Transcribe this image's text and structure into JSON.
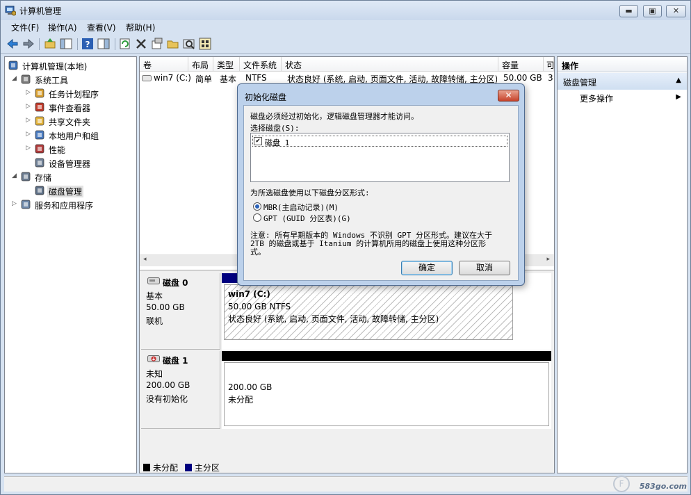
{
  "window": {
    "title": "计算机管理"
  },
  "menu": [
    "文件(F)",
    "操作(A)",
    "查看(V)",
    "帮助(H)"
  ],
  "tree": [
    {
      "label": "计算机管理(本地)",
      "level": 0,
      "expander": ""
    },
    {
      "label": "系统工具",
      "level": 1,
      "expander": "◢"
    },
    {
      "label": "任务计划程序",
      "level": 2,
      "expander": "▷"
    },
    {
      "label": "事件查看器",
      "level": 2,
      "expander": "▷"
    },
    {
      "label": "共享文件夹",
      "level": 2,
      "expander": "▷"
    },
    {
      "label": "本地用户和组",
      "level": 2,
      "expander": "▷"
    },
    {
      "label": "性能",
      "level": 2,
      "expander": "▷"
    },
    {
      "label": "设备管理器",
      "level": 2,
      "expander": ""
    },
    {
      "label": "存储",
      "level": 1,
      "expander": "◢"
    },
    {
      "label": "磁盘管理",
      "level": 2,
      "expander": "",
      "selected": true
    },
    {
      "label": "服务和应用程序",
      "level": 1,
      "expander": "▷"
    }
  ],
  "volume_list": {
    "headers": [
      "卷",
      "布局",
      "类型",
      "文件系统",
      "状态",
      "容量",
      "可"
    ],
    "rows": [
      {
        "volume": "win7 (C:)",
        "layout": "简单",
        "type": "基本",
        "fs": "NTFS",
        "status": "状态良好 (系统, 启动, 页面文件, 活动, 故障转储, 主分区)",
        "capacity": "50.00 GB",
        "free": "3"
      }
    ]
  },
  "disks": [
    {
      "name": "磁盘 0",
      "kind": "基本",
      "size": "50.00 GB",
      "state": "联机",
      "volume": {
        "name": "win7  (C:)",
        "size": "50.00 GB NTFS",
        "status": "状态良好 (系统, 启动, 页面文件, 活动, 故障转储, 主分区)"
      }
    },
    {
      "name": "磁盘 1",
      "kind": "未知",
      "size": "200.00 GB",
      "state": "没有初始化",
      "volume": {
        "size": "200.00 GB",
        "status": "未分配"
      }
    }
  ],
  "legend": {
    "unallocated": "未分配",
    "primary": "主分区"
  },
  "colors": {
    "unallocated": "#000000",
    "primary": "#00007f"
  },
  "actions": {
    "header": "操作",
    "section": "磁盘管理",
    "more": "更多操作"
  },
  "dialog": {
    "title": "初始化磁盘",
    "intro": "磁盘必须经过初始化，逻辑磁盘管理器才能访问。",
    "select_label": "选择磁盘(S):",
    "disk_item": "磁盘 1",
    "disk_checked": true,
    "style_label": "为所选磁盘使用以下磁盘分区形式:",
    "mbr_option": "MBR(主启动记录)(M)",
    "gpt_option": "GPT (GUID 分区表)(G)",
    "selected_style": "MBR",
    "note_1": "注意: 所有早期版本的 Windows 不识别 GPT 分区形式。建议在大于",
    "note_2": "2TB 的磁盘或基于 Itanium 的计算机所用的磁盘上使用这种分区形",
    "note_3": "式。",
    "ok": "确定",
    "cancel": "取消"
  },
  "watermark": {
    "text": "583go.com",
    "glyph": "F"
  }
}
